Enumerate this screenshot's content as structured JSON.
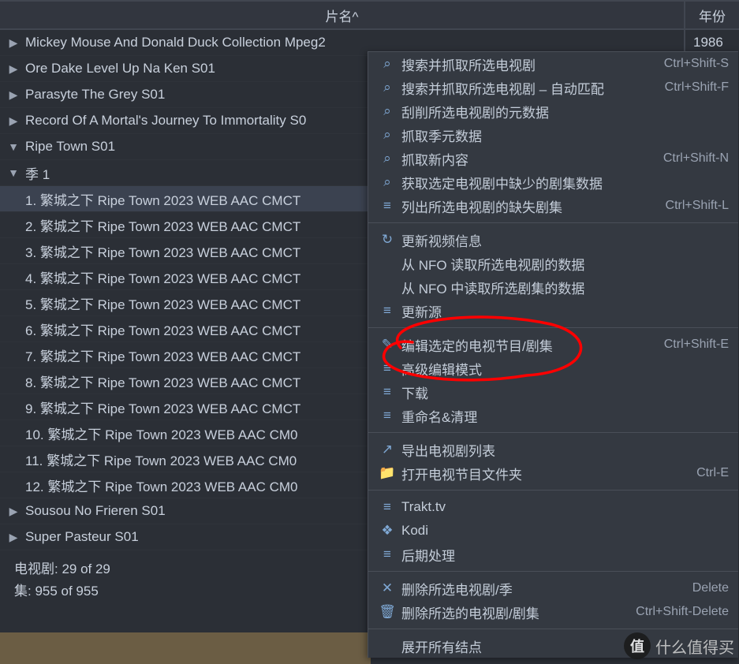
{
  "header": {
    "title": "片名^",
    "year": "年份"
  },
  "tree": [
    {
      "type": "top",
      "expanded": false,
      "label": "Mickey Mouse And Donald Duck Collection Mpeg2",
      "year": "1986"
    },
    {
      "type": "top",
      "expanded": false,
      "label": "Ore Dake Level Up Na Ken S01",
      "year": ""
    },
    {
      "type": "top",
      "expanded": false,
      "label": "Parasyte The Grey S01",
      "year": ""
    },
    {
      "type": "top",
      "expanded": false,
      "label": "Record Of A Mortal's Journey To Immortality S0",
      "year": ""
    },
    {
      "type": "top",
      "expanded": true,
      "label": "Ripe Town S01",
      "year": ""
    },
    {
      "type": "season",
      "expanded": true,
      "label": "季 1",
      "year": ""
    },
    {
      "type": "ep",
      "selected": true,
      "label": "1. 繁城之下 Ripe Town 2023 WEB AAC CMCT",
      "year": ""
    },
    {
      "type": "ep",
      "label": "2. 繁城之下 Ripe Town 2023 WEB AAC CMCT",
      "year": ""
    },
    {
      "type": "ep",
      "label": "3. 繁城之下 Ripe Town 2023 WEB AAC CMCT",
      "year": ""
    },
    {
      "type": "ep",
      "label": "4. 繁城之下 Ripe Town 2023 WEB AAC CMCT",
      "year": ""
    },
    {
      "type": "ep",
      "label": "5. 繁城之下 Ripe Town 2023 WEB AAC CMCT",
      "year": ""
    },
    {
      "type": "ep",
      "label": "6. 繁城之下 Ripe Town 2023 WEB AAC CMCT",
      "year": ""
    },
    {
      "type": "ep",
      "label": "7. 繁城之下 Ripe Town 2023 WEB AAC CMCT",
      "year": ""
    },
    {
      "type": "ep",
      "label": "8. 繁城之下 Ripe Town 2023 WEB AAC CMCT",
      "year": ""
    },
    {
      "type": "ep",
      "label": "9. 繁城之下 Ripe Town 2023 WEB AAC CMCT",
      "year": ""
    },
    {
      "type": "ep",
      "label": "10. 繁城之下 Ripe Town 2023 WEB AAC CM0",
      "year": ""
    },
    {
      "type": "ep",
      "label": "11. 繁城之下 Ripe Town 2023 WEB AAC CM0",
      "year": ""
    },
    {
      "type": "ep",
      "label": "12. 繁城之下 Ripe Town 2023 WEB AAC CM0",
      "year": ""
    },
    {
      "type": "top",
      "expanded": false,
      "label": "Sousou No Frieren S01",
      "year": ""
    },
    {
      "type": "top",
      "expanded": false,
      "label": "Super Pasteur S01",
      "year": ""
    }
  ],
  "stats": {
    "shows": "电视剧: 29 of 29",
    "episodes": "集: 955 of 955"
  },
  "menu": [
    {
      "icon": "search",
      "label": "搜索并抓取所选电视剧",
      "shortcut": "Ctrl+Shift-S"
    },
    {
      "icon": "search",
      "label": "搜索并抓取所选电视剧 – 自动匹配",
      "shortcut": "Ctrl+Shift-F"
    },
    {
      "icon": "search",
      "label": "刮削所选电视剧的元数据",
      "shortcut": ""
    },
    {
      "icon": "search",
      "label": "抓取季元数据",
      "shortcut": ""
    },
    {
      "icon": "search",
      "label": "抓取新内容",
      "shortcut": "Ctrl+Shift-N"
    },
    {
      "icon": "search",
      "label": "获取选定电视剧中缺少的剧集数据",
      "shortcut": ""
    },
    {
      "icon": "list",
      "label": "列出所选电视剧的缺失剧集",
      "shortcut": "Ctrl+Shift-L"
    },
    {
      "sep": true
    },
    {
      "icon": "refresh",
      "label": "更新视频信息",
      "shortcut": ""
    },
    {
      "icon": "",
      "label": "从 NFO 读取所选电视剧的数据",
      "shortcut": ""
    },
    {
      "icon": "",
      "label": "从 NFO 中读取所选剧集的数据",
      "shortcut": ""
    },
    {
      "icon": "list",
      "label": "更新源",
      "shortcut": ""
    },
    {
      "sep": true
    },
    {
      "icon": "edit",
      "label": "编辑选定的电视节目/剧集",
      "shortcut": "Ctrl+Shift-E"
    },
    {
      "icon": "list",
      "label": "高级编辑模式",
      "shortcut": ""
    },
    {
      "icon": "list",
      "label": "下载",
      "shortcut": ""
    },
    {
      "icon": "list",
      "label": "重命名&清理",
      "shortcut": ""
    },
    {
      "sep": true
    },
    {
      "icon": "export",
      "label": "导出电视剧列表",
      "shortcut": ""
    },
    {
      "icon": "folder",
      "label": "打开电视节目文件夹",
      "shortcut": "Ctrl-E"
    },
    {
      "sep": true
    },
    {
      "icon": "list",
      "label": "Trakt.tv",
      "shortcut": ""
    },
    {
      "icon": "kodi",
      "label": "Kodi",
      "shortcut": ""
    },
    {
      "icon": "list",
      "label": "后期处理",
      "shortcut": ""
    },
    {
      "sep": true
    },
    {
      "icon": "close",
      "label": "删除所选电视剧/季",
      "shortcut": "Delete"
    },
    {
      "icon": "trash",
      "label": "删除所选的电视剧/剧集",
      "shortcut": "Ctrl+Shift-Delete"
    },
    {
      "sep": true
    },
    {
      "icon": "",
      "label": "展开所有结点",
      "shortcut": ""
    }
  ],
  "watermark": "什么值得买",
  "icons": {
    "search": "⌕",
    "list": "≡",
    "refresh": "↻",
    "edit": "✎",
    "export": "↗",
    "folder": "📁",
    "kodi": "❖",
    "close": "✕",
    "trash": "🗑",
    "right": "▶",
    "down": "▼"
  }
}
